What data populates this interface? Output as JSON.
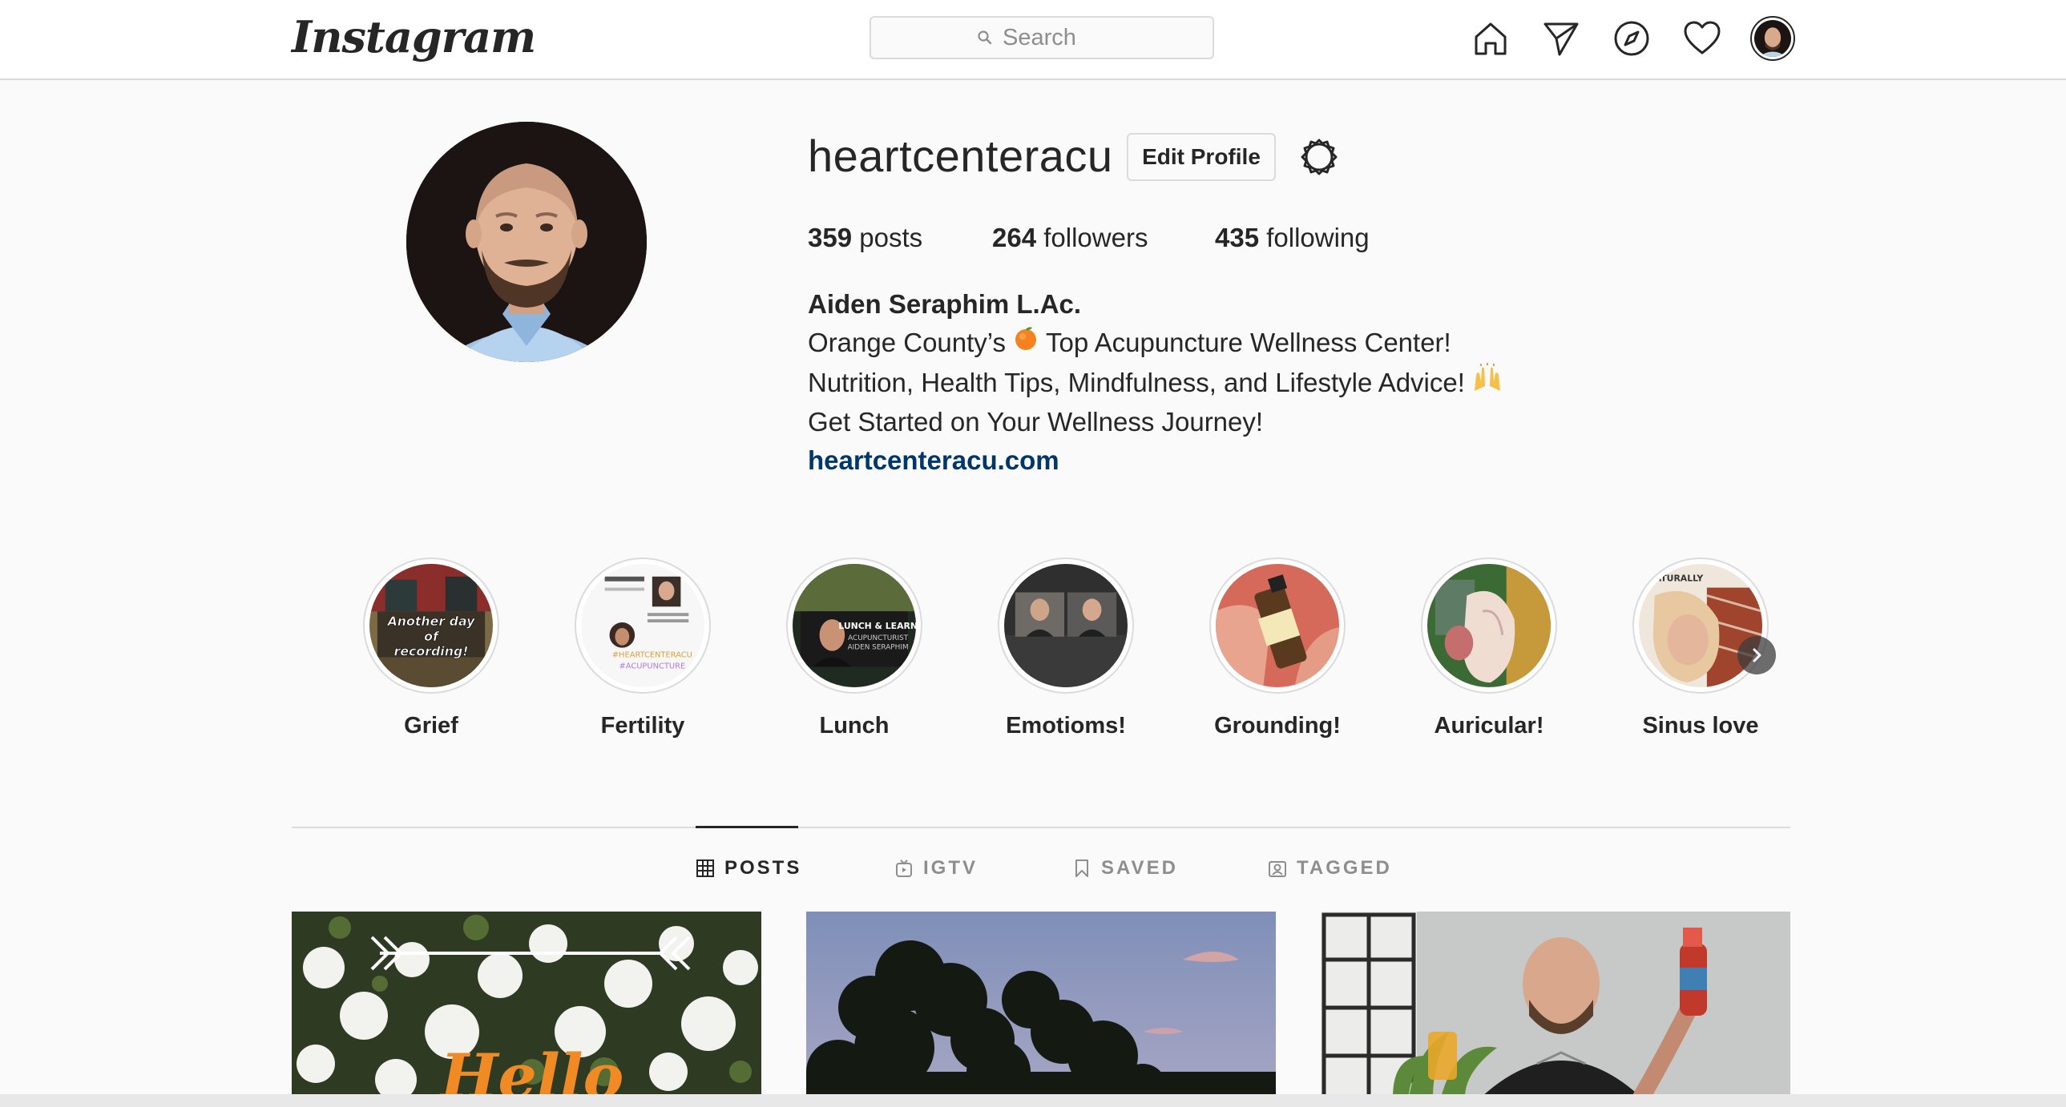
{
  "nav": {
    "logo": "Instagram",
    "search_placeholder": "Search",
    "icons": [
      "home-icon",
      "direct-icon",
      "explore-icon",
      "activity-icon",
      "profile-avatar"
    ]
  },
  "profile": {
    "username": "heartcenteracu",
    "edit_label": "Edit Profile",
    "stats": {
      "posts_count": "359",
      "posts_label": "posts",
      "followers_count": "264",
      "followers_label": "followers",
      "following_count": "435",
      "following_label": "following"
    },
    "bio": {
      "name": "Aiden Seraphim L.Ac.",
      "line1_before": "Orange County’s",
      "line1_emoji": "orange-emoji",
      "line1_after": "Top Acupuncture Wellness Center!",
      "line2": "Nutrition, Health Tips, Mindfulness, and Lifestyle Advice!",
      "line2_emoji": "raised-hands-emoji",
      "line3": "Get Started on Your Wellness Journey!",
      "website": "heartcenteracu.com"
    }
  },
  "highlights": [
    {
      "label": "Grief",
      "thumb_text": "Another day of recording!"
    },
    {
      "label": "Fertility",
      "thumb_text": "#HEARTCENTERACU"
    },
    {
      "label": "Lunch",
      "thumb_text": "LUNCH & LEARN"
    },
    {
      "label": "Emotioms!"
    },
    {
      "label": "Grounding!"
    },
    {
      "label": "Auricular!"
    },
    {
      "label": "Sinus love",
      "thumb_text": "NATURALLY"
    }
  ],
  "tabs": [
    {
      "label": "POSTS",
      "icon": "grid-icon",
      "active": true
    },
    {
      "label": "IGTV",
      "icon": "igtv-icon",
      "active": false
    },
    {
      "label": "SAVED",
      "icon": "bookmark-icon",
      "active": false
    },
    {
      "label": "TAGGED",
      "icon": "tagged-icon",
      "active": false
    }
  ],
  "posts": [
    {
      "alt": "white roses",
      "overlay_text": "Hello"
    },
    {
      "alt": "trees at dusk"
    },
    {
      "alt": "man holding juice bottle"
    }
  ],
  "colors": {
    "link": "#00376b",
    "border": "#dbdbdb",
    "muted": "#8e8e8e",
    "text": "#262626",
    "orange_text": "#f08a24"
  }
}
